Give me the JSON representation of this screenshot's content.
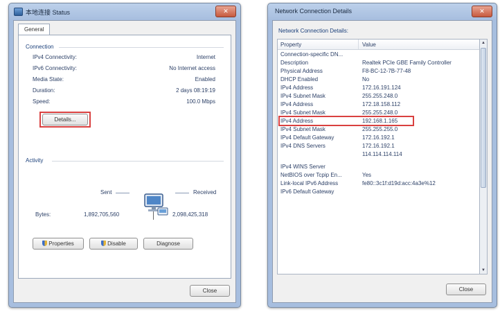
{
  "status_window": {
    "title": "本地连接 Status",
    "tab": "General",
    "connection_label": "Connection",
    "rows": [
      {
        "key": "IPv4 Connectivity:",
        "value": "Internet"
      },
      {
        "key": "IPv6 Connectivity:",
        "value": "No Internet access"
      },
      {
        "key": "Media State:",
        "value": "Enabled"
      },
      {
        "key": "Duration:",
        "value": "2 days 08:19:19"
      },
      {
        "key": "Speed:",
        "value": "100.0 Mbps"
      }
    ],
    "details_button": "Details...",
    "activity_label": "Activity",
    "sent_label": "Sent",
    "received_label": "Received",
    "bytes_label": "Bytes:",
    "bytes_sent": "1,892,705,560",
    "bytes_received": "2,098,425,318",
    "properties_button": "Properties",
    "disable_button": "Disable",
    "diagnose_button": "Diagnose",
    "close_button": "Close",
    "close_x": "✕"
  },
  "details_window": {
    "title": "Network Connection Details",
    "heading": "Network Connection Details:",
    "col_property": "Property",
    "col_value": "Value",
    "rows": [
      {
        "p": "Connection-specific DN...",
        "v": ""
      },
      {
        "p": "Description",
        "v": "Realtek PCIe GBE Family Controller"
      },
      {
        "p": "Physical Address",
        "v": "F8-BC-12-7B-77-48"
      },
      {
        "p": "DHCP Enabled",
        "v": "No"
      },
      {
        "p": "IPv4 Address",
        "v": "172.16.191.124"
      },
      {
        "p": "IPv4 Subnet Mask",
        "v": "255.255.248.0"
      },
      {
        "p": "IPv4 Address",
        "v": "172.18.158.112"
      },
      {
        "p": "IPv4 Subnet Mask",
        "v": "255.255.248.0"
      },
      {
        "p": "IPv4 Address",
        "v": "192.168.1.165"
      },
      {
        "p": "IPv4 Subnet Mask",
        "v": "255.255.255.0"
      },
      {
        "p": "IPv4 Default Gateway",
        "v": "172.16.192.1"
      },
      {
        "p": "IPv4 DNS Servers",
        "v": "172.16.192.1"
      },
      {
        "p": "",
        "v": "114.114.114.114"
      },
      {
        "p": "IPv4 WINS Server",
        "v": ""
      },
      {
        "p": "NetBIOS over Tcpip En...",
        "v": "Yes"
      },
      {
        "p": "Link-local IPv6 Address",
        "v": "fe80::3c1f:d19d:acc:4a3e%12"
      },
      {
        "p": "IPv6 Default Gateway",
        "v": ""
      }
    ],
    "close_button": "Close",
    "close_x": "✕"
  }
}
